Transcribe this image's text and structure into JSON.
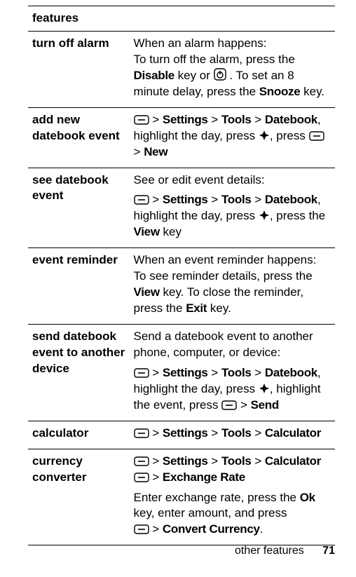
{
  "header": "features",
  "rows": [
    {
      "feature": "turn off alarm",
      "desc_parts": [
        {
          "t": "text",
          "v": "When an alarm happens:"
        },
        {
          "t": "br"
        },
        {
          "t": "text",
          "v": "To turn off the alarm, press the "
        },
        {
          "t": "cond",
          "v": "Disable"
        },
        {
          "t": "text",
          "v": " key or "
        },
        {
          "t": "icon",
          "v": "power-icon"
        },
        {
          "t": "text",
          "v": " . To set an 8 minute delay, press the "
        },
        {
          "t": "cond",
          "v": "Snooze"
        },
        {
          "t": "text",
          "v": " key."
        }
      ]
    },
    {
      "feature": "add new datebook event",
      "desc_parts": [
        {
          "t": "icon",
          "v": "softkey-icon"
        },
        {
          "t": "text",
          "v": " > "
        },
        {
          "t": "cond",
          "v": "Settings"
        },
        {
          "t": "text",
          "v": " > "
        },
        {
          "t": "cond",
          "v": "Tools"
        },
        {
          "t": "text",
          "v": " > "
        },
        {
          "t": "cond",
          "v": "Datebook"
        },
        {
          "t": "text",
          "v": ", highlight the day, press "
        },
        {
          "t": "icon",
          "v": "nav-icon"
        },
        {
          "t": "text",
          "v": ", press "
        },
        {
          "t": "icon",
          "v": "softkey-icon"
        },
        {
          "t": "text",
          "v": " > "
        },
        {
          "t": "cond",
          "v": "New"
        }
      ]
    },
    {
      "feature": "see datebook event",
      "desc_parts": [
        {
          "t": "text",
          "v": "See or edit event details:"
        },
        {
          "t": "block"
        },
        {
          "t": "icon",
          "v": "softkey-icon"
        },
        {
          "t": "text",
          "v": " > "
        },
        {
          "t": "cond",
          "v": "Settings"
        },
        {
          "t": "text",
          "v": " > "
        },
        {
          "t": "cond",
          "v": "Tools"
        },
        {
          "t": "text",
          "v": " > "
        },
        {
          "t": "cond",
          "v": "Datebook"
        },
        {
          "t": "text",
          "v": ", highlight the day, press "
        },
        {
          "t": "icon",
          "v": "nav-icon"
        },
        {
          "t": "text",
          "v": ", press the "
        },
        {
          "t": "cond",
          "v": "View"
        },
        {
          "t": "text",
          "v": " key"
        }
      ]
    },
    {
      "feature": "event reminder",
      "desc_parts": [
        {
          "t": "text",
          "v": "When an event reminder happens:"
        },
        {
          "t": "br"
        },
        {
          "t": "text",
          "v": "To see reminder details, press the "
        },
        {
          "t": "cond",
          "v": "View"
        },
        {
          "t": "text",
          "v": " key. To close the reminder, press the "
        },
        {
          "t": "cond",
          "v": "Exit"
        },
        {
          "t": "text",
          "v": " key."
        }
      ]
    },
    {
      "feature": "send datebook event to another device",
      "desc_parts": [
        {
          "t": "text",
          "v": "Send a datebook event to another phone, computer, or device:"
        },
        {
          "t": "block"
        },
        {
          "t": "icon",
          "v": "softkey-icon"
        },
        {
          "t": "text",
          "v": " > "
        },
        {
          "t": "cond",
          "v": "Settings"
        },
        {
          "t": "text",
          "v": " > "
        },
        {
          "t": "cond",
          "v": "Tools"
        },
        {
          "t": "text",
          "v": " > "
        },
        {
          "t": "cond",
          "v": "Datebook"
        },
        {
          "t": "text",
          "v": ", highlight the day, press "
        },
        {
          "t": "icon",
          "v": "nav-icon"
        },
        {
          "t": "text",
          "v": ", highlight the event, press "
        },
        {
          "t": "icon",
          "v": "softkey-icon"
        },
        {
          "t": "text",
          "v": " > "
        },
        {
          "t": "cond",
          "v": "Send"
        }
      ]
    },
    {
      "feature": "calculator",
      "desc_parts": [
        {
          "t": "icon",
          "v": "softkey-icon"
        },
        {
          "t": "text",
          "v": " > "
        },
        {
          "t": "cond",
          "v": "Settings"
        },
        {
          "t": "text",
          "v": " > "
        },
        {
          "t": "cond",
          "v": "Tools"
        },
        {
          "t": "text",
          "v": " > "
        },
        {
          "t": "cond",
          "v": "Calculator"
        }
      ]
    },
    {
      "feature": "currency converter",
      "desc_parts": [
        {
          "t": "icon",
          "v": "softkey-icon"
        },
        {
          "t": "text",
          "v": " > "
        },
        {
          "t": "cond",
          "v": "Settings"
        },
        {
          "t": "text",
          "v": " > "
        },
        {
          "t": "cond",
          "v": "Tools"
        },
        {
          "t": "text",
          "v": " > "
        },
        {
          "t": "cond",
          "v": "Calculator"
        },
        {
          "t": "br"
        },
        {
          "t": "icon",
          "v": "softkey-icon"
        },
        {
          "t": "text",
          "v": " > "
        },
        {
          "t": "cond",
          "v": "Exchange Rate"
        },
        {
          "t": "block"
        },
        {
          "t": "text",
          "v": "Enter exchange rate, press the "
        },
        {
          "t": "cond",
          "v": "Ok"
        },
        {
          "t": "text",
          "v": " key, enter amount, and press"
        },
        {
          "t": "br"
        },
        {
          "t": "icon",
          "v": "softkey-icon"
        },
        {
          "t": "text",
          "v": " > "
        },
        {
          "t": "cond",
          "v": "Convert Currency"
        },
        {
          "t": "text",
          "v": "."
        }
      ]
    }
  ],
  "footer": {
    "section": "other features",
    "page": "71"
  }
}
